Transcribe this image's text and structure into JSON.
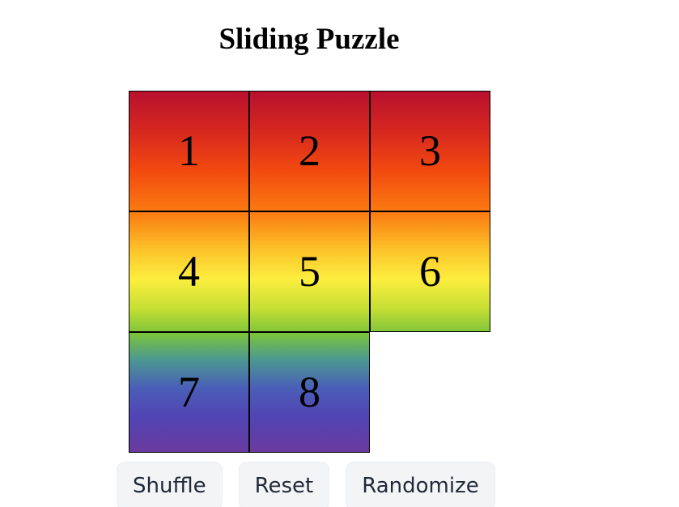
{
  "title": "Sliding Puzzle",
  "board": {
    "rows": 3,
    "cols": 3,
    "tiles": [
      "1",
      "2",
      "3",
      "4",
      "5",
      "6",
      "7",
      "8",
      ""
    ],
    "empty_index": 8,
    "gradient_colors": [
      "#b8102f",
      "#f24a0f",
      "#fb7e12",
      "#fdee3e",
      "#7cc43a",
      "#4a5fb8",
      "#6a3a9e"
    ]
  },
  "buttons": {
    "shuffle": "Shuffle",
    "reset": "Reset",
    "randomize": "Randomize"
  }
}
